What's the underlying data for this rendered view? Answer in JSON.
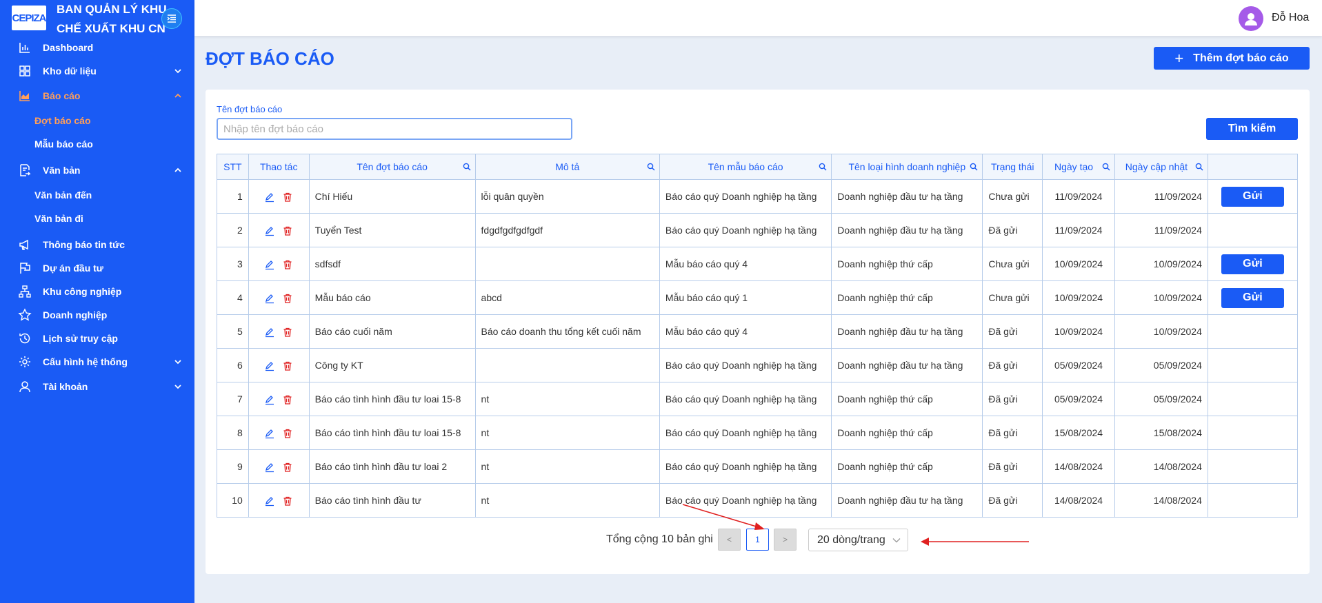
{
  "brand": {
    "logo": "CEPIZA",
    "line1": "BAN QUẢN LÝ KHU",
    "line2": "CHẾ XUẤT KHU CN"
  },
  "sidebar": {
    "items": [
      {
        "label": "Dashboard",
        "icon": "bar-chart-icon"
      },
      {
        "label": "Kho dữ liệu",
        "icon": "grid-icon"
      },
      {
        "label": "Báo cáo",
        "icon": "area-chart-icon"
      },
      {
        "label": "Văn bản",
        "icon": "document-icon"
      },
      {
        "label": "Thông báo tin tức",
        "icon": "megaphone-icon"
      },
      {
        "label": "Dự án đầu tư",
        "icon": "flag-icon"
      },
      {
        "label": "Khu công nghiệp",
        "icon": "org-chart-icon"
      },
      {
        "label": "Doanh nghiệp",
        "icon": "star-icon"
      },
      {
        "label": "Lịch sử truy cập",
        "icon": "history-icon"
      },
      {
        "label": "Cấu hình hệ thống",
        "icon": "gear-icon"
      },
      {
        "label": "Tài khoản",
        "icon": "user-icon"
      }
    ],
    "sub_bao_cao": [
      "Đợt báo cáo",
      "Mẫu báo cáo"
    ],
    "sub_van_ban": [
      "Văn bản đến",
      "Văn bản đi"
    ]
  },
  "header": {
    "username": "Đỗ Hoa"
  },
  "page": {
    "title": "ĐỢT BÁO CÁO",
    "add_label": "Thêm đợt báo cáo",
    "field_label": "Tên đợt báo cáo",
    "search_placeholder": "Nhập tên đợt báo cáo",
    "search_label": "Tìm kiếm"
  },
  "table": {
    "headers": [
      "STT",
      "Thao tác",
      "Tên đợt báo cáo",
      "Mô tả",
      "Tên mẫu báo cáo",
      "Tên loại hình doanh nghiệp",
      "Trạng thái",
      "Ngày tạo",
      "Ngày cập nhật"
    ],
    "send_label": "Gửi",
    "rows": [
      {
        "stt": "1",
        "name": "Chí Hiếu",
        "desc": "lỗi quân quyền",
        "template": "Báo cáo quý Doanh nghiệp hạ tầng",
        "type": "Doanh nghiệp đầu tư hạ tầng",
        "status": "Chưa gửi",
        "created": "11/09/2024",
        "updated": "11/09/2024"
      },
      {
        "stt": "2",
        "name": "Tuyển Test",
        "desc": "fdgdfgdfgdfgdf",
        "template": "Báo cáo quý Doanh nghiệp hạ tầng",
        "type": "Doanh nghiệp đầu tư hạ tầng",
        "status": "Đã gửi",
        "created": "11/09/2024",
        "updated": "11/09/2024"
      },
      {
        "stt": "3",
        "name": "sdfsdf",
        "desc": "",
        "template": "Mẫu báo cáo quý 4",
        "type": "Doanh nghiệp thứ cấp",
        "status": "Chưa gửi",
        "created": "10/09/2024",
        "updated": "10/09/2024"
      },
      {
        "stt": "4",
        "name": "Mẫu báo cáo",
        "desc": "abcd",
        "template": "Mẫu báo cáo quý 1",
        "type": "Doanh nghiệp thứ cấp",
        "status": "Chưa gửi",
        "created": "10/09/2024",
        "updated": "10/09/2024"
      },
      {
        "stt": "5",
        "name": "Báo cáo cuối năm",
        "desc": "Báo cáo doanh thu tổng kết cuối năm",
        "template": "Mẫu báo cáo quý 4",
        "type": "Doanh nghiệp đầu tư hạ tầng",
        "status": "Đã gửi",
        "created": "10/09/2024",
        "updated": "10/09/2024"
      },
      {
        "stt": "6",
        "name": "Công ty KT",
        "desc": "",
        "template": "Báo cáo quý Doanh nghiệp hạ tầng",
        "type": "Doanh nghiệp đầu tư hạ tầng",
        "status": "Đã gửi",
        "created": "05/09/2024",
        "updated": "05/09/2024"
      },
      {
        "stt": "7",
        "name": "Báo cáo tình hình đầu tư loai 15-8",
        "desc": "nt",
        "template": "Báo cáo quý Doanh nghiệp hạ tầng",
        "type": "Doanh nghiệp thứ cấp",
        "status": "Đã gửi",
        "created": "05/09/2024",
        "updated": "05/09/2024"
      },
      {
        "stt": "8",
        "name": "Báo cáo tình hình đầu tư loai 15-8",
        "desc": "nt",
        "template": "Báo cáo quý Doanh nghiệp hạ tầng",
        "type": "Doanh nghiệp thứ cấp",
        "status": "Đã gửi",
        "created": "15/08/2024",
        "updated": "15/08/2024"
      },
      {
        "stt": "9",
        "name": "Báo cáo tình hình đầu tư loai 2",
        "desc": "nt",
        "template": "Báo cáo quý Doanh nghiệp hạ tầng",
        "type": "Doanh nghiệp thứ cấp",
        "status": "Đã gửi",
        "created": "14/08/2024",
        "updated": "14/08/2024"
      },
      {
        "stt": "10",
        "name": "Báo cáo tình hình đầu tư",
        "desc": "nt",
        "template": "Báo cáo quý Doanh nghiệp hạ tầng",
        "type": "Doanh nghiệp đầu tư hạ tầng",
        "status": "Đã gửi",
        "created": "14/08/2024",
        "updated": "14/08/2024"
      }
    ]
  },
  "pagination": {
    "total": "Tổng cộng 10 bản ghi",
    "prev": "<",
    "current": "1",
    "next": ">",
    "page_size": "20 dòng/trang"
  },
  "colors": {
    "primary": "#1a5bf5",
    "active_nav": "#ff9f5a",
    "status_pending": "#1aa64a",
    "status_sent": "#e8951b",
    "annotation_arrow": "#e02020"
  }
}
